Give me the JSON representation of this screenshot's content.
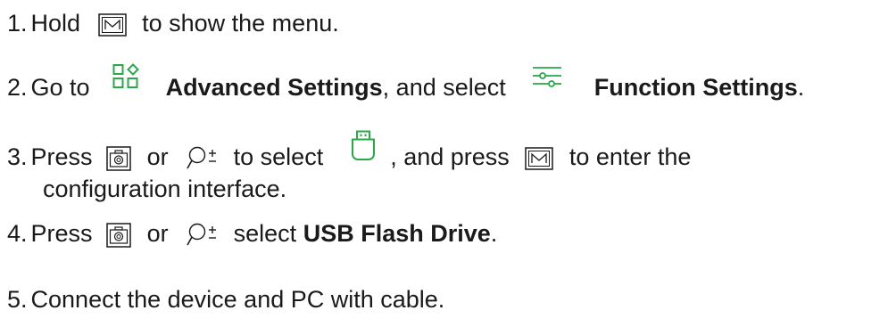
{
  "accent_color": "#2aa84a",
  "text_color": "#1a1a1a",
  "steps": [
    {
      "number": "1.",
      "text_a": "Hold",
      "icon_a": "menu-m-key-icon",
      "text_b": "to show the menu."
    },
    {
      "number": "2.",
      "text_a": "Go to",
      "icon_a": "advanced-settings-grid-icon",
      "bold_a": "Advanced Settings",
      "text_b": ", and select",
      "icon_b": "function-settings-sliders-icon",
      "bold_b": "Function Settings",
      "text_c": "."
    },
    {
      "number": "3.",
      "text_a": "Press",
      "icon_a": "camera-key-icon",
      "text_b": "or",
      "icon_b": "zoom-key-icon",
      "text_c": "to select",
      "icon_c": "usb-icon",
      "text_d": ", and press",
      "icon_d": "menu-m-key-icon",
      "text_e": "to enter the",
      "text_f": "configuration interface."
    },
    {
      "number": "4.",
      "text_a": "Press",
      "icon_a": "camera-key-icon",
      "text_b": "or",
      "icon_b": "zoom-key-icon",
      "text_c": "select",
      "bold_a": "USB Flash Drive",
      "text_d": "."
    },
    {
      "number": "5.",
      "text_a": "Connect the device and PC with cable."
    }
  ]
}
